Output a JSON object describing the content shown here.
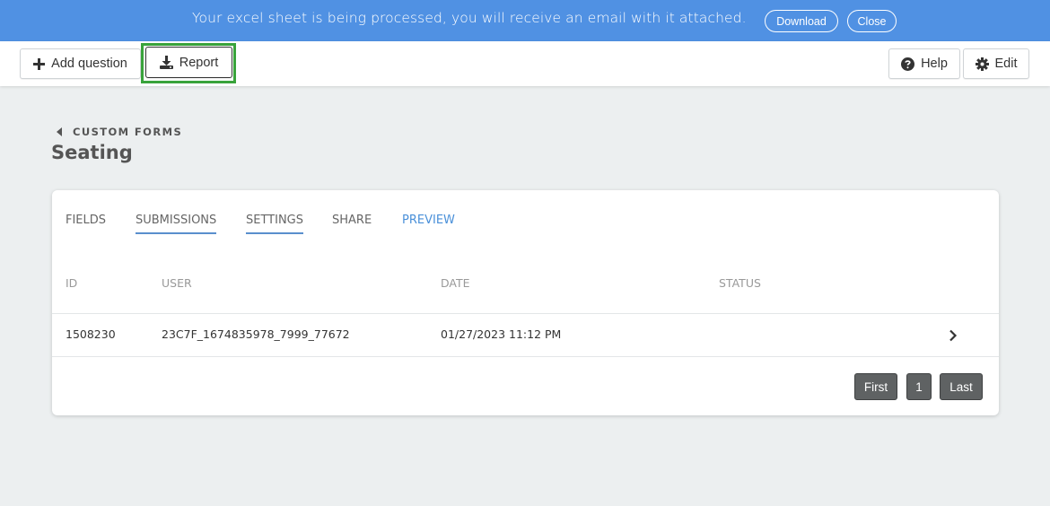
{
  "banner": {
    "message": "Your excel sheet is being processed, you will receive an email with it attached.",
    "download_label": "Download",
    "close_label": "Close",
    "background_color": "#5091e3"
  },
  "toolbar": {
    "add_question_label": "Add question",
    "add_question_icon": "plus-icon",
    "report_label": "Report",
    "report_icon": "download-icon",
    "help_label": "Help",
    "help_icon": "question-circle-icon",
    "edit_label": "Edit",
    "edit_icon": "gear-icon",
    "highlight_color": "#39a33b"
  },
  "breadcrumb": {
    "label": "CUSTOM FORMS",
    "icon": "caret-left-icon"
  },
  "page": {
    "title": "Seating"
  },
  "tabs": [
    {
      "label": "FIELDS"
    },
    {
      "label": "SUBMISSIONS"
    },
    {
      "label": "SETTINGS"
    },
    {
      "label": "SHARE"
    },
    {
      "label": "PREVIEW"
    }
  ],
  "table": {
    "headers": [
      "ID",
      "USER",
      "DATE",
      "STATUS"
    ],
    "rows": [
      {
        "id": "1508230",
        "user": "23C7F_1674835978_7999_77672",
        "date": "01/27/2023 11:12 PM",
        "status": ""
      }
    ]
  },
  "pagination": {
    "first_label": "First",
    "current_page": "1",
    "last_label": "Last"
  }
}
